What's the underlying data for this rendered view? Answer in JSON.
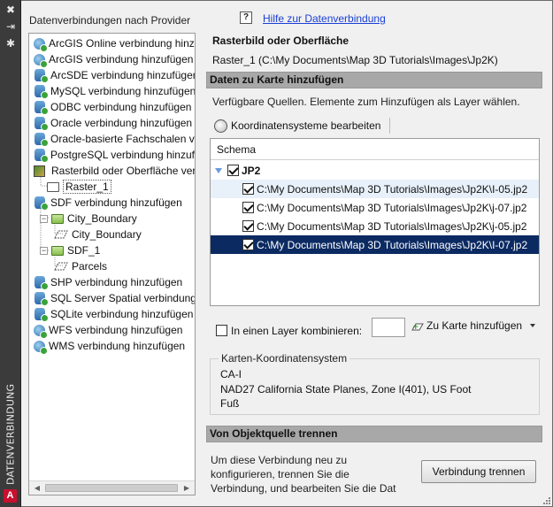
{
  "titlebar": {
    "title": "DATENVERBINDUNG",
    "logo": "A",
    "icons": [
      "close-icon",
      "pin-icon",
      "settings-icon"
    ]
  },
  "left": {
    "header": "Datenverbindungen nach Provider",
    "items": [
      {
        "label": "ArcGIS Online verbindung hinzufügen",
        "icon": "globe-connect-icon"
      },
      {
        "label": "ArcGIS verbindung hinzufügen",
        "icon": "globe-connect-icon"
      },
      {
        "label": "ArcSDE verbindung hinzufügen",
        "icon": "database-connect-icon"
      },
      {
        "label": "MySQL verbindung hinzufügen",
        "icon": "database-connect-icon"
      },
      {
        "label": "ODBC verbindung hinzufügen",
        "icon": "database-connect-icon"
      },
      {
        "label": "Oracle verbindung hinzufügen",
        "icon": "database-connect-icon"
      },
      {
        "label": "Oracle-basierte Fachschalen verbindung hinzufügen",
        "icon": "database-connect-icon"
      },
      {
        "label": "PostgreSQL verbindung hinzufügen",
        "icon": "database-connect-icon"
      },
      {
        "label": "Rasterbild oder Oberfläche verbindung hinzufügen",
        "icon": "raster-icon"
      },
      {
        "label": "Raster_1",
        "icon": "folder-icon"
      },
      {
        "label": "SDF verbindung hinzufügen",
        "icon": "database-connect-icon"
      },
      {
        "label": "City_Boundary",
        "icon": "folder-green-icon"
      },
      {
        "label": "City_Boundary",
        "icon": "polygon-icon"
      },
      {
        "label": "SDF_1",
        "icon": "folder-green-icon"
      },
      {
        "label": "Parcels",
        "icon": "polygon-icon"
      },
      {
        "label": "SHP verbindung hinzufügen",
        "icon": "database-connect-icon"
      },
      {
        "label": "SQL Server Spatial verbindung hinzufügen",
        "icon": "database-connect-icon"
      },
      {
        "label": "SQLite verbindung hinzufügen",
        "icon": "database-connect-icon"
      },
      {
        "label": "WFS verbindung hinzufügen",
        "icon": "globe-connect-icon"
      },
      {
        "label": "WMS verbindung hinzufügen",
        "icon": "globe-connect-icon"
      }
    ]
  },
  "right": {
    "help_link": "Hilfe zur Datenverbindung",
    "help_icon": "?",
    "source_title": "Rasterbild oder Oberfläche",
    "source_path": "Raster_1 (C:\\My Documents\\Map 3D Tutorials\\Images\\Jp2K)",
    "add_section": "Daten zu Karte hinzufügen",
    "hint": "Verfügbare Quellen. Elemente zum Hinzufügen als Layer wählen.",
    "edit_cs_button": "Koordinatensysteme bearbeiten",
    "grid": {
      "header": "Schema",
      "group": {
        "label": "JP2",
        "checked": true
      },
      "rows": [
        {
          "label": "C:\\My Documents\\Map 3D Tutorials\\Images\\Jp2K\\I-05.jp2",
          "checked": true
        },
        {
          "label": "C:\\My Documents\\Map 3D Tutorials\\Images\\Jp2K\\j-07.jp2",
          "checked": true
        },
        {
          "label": "C:\\My Documents\\Map 3D Tutorials\\Images\\Jp2K\\j-05.jp2",
          "checked": true
        },
        {
          "label": "C:\\My Documents\\Map 3D Tutorials\\Images\\Jp2K\\I-07.jp2",
          "checked": true
        }
      ]
    },
    "combine_label": "In einen Layer kombinieren:",
    "combine_value": "",
    "add_to_map_button": "Zu Karte hinzufügen",
    "cs_legend": "Karten-Koordinatensystem",
    "cs_code": "CA-I",
    "cs_name": "NAD27 California State Planes, Zone I(401), US Foot",
    "cs_unit": "Fuß",
    "disconnect_section": "Von Objektquelle trennen",
    "disconnect_desc": [
      "Um diese Verbindung neu zu",
      "konfigurieren, trennen Sie die",
      "Verbindung, und bearbeiten Sie die Dat"
    ],
    "disconnect_button": "Verbindung trennen"
  },
  "colors": {
    "link": "#1a3fd6",
    "selection": "#0c2a62",
    "section_bar": "#a8a8a8",
    "titlebar": "#3b3b3b"
  }
}
